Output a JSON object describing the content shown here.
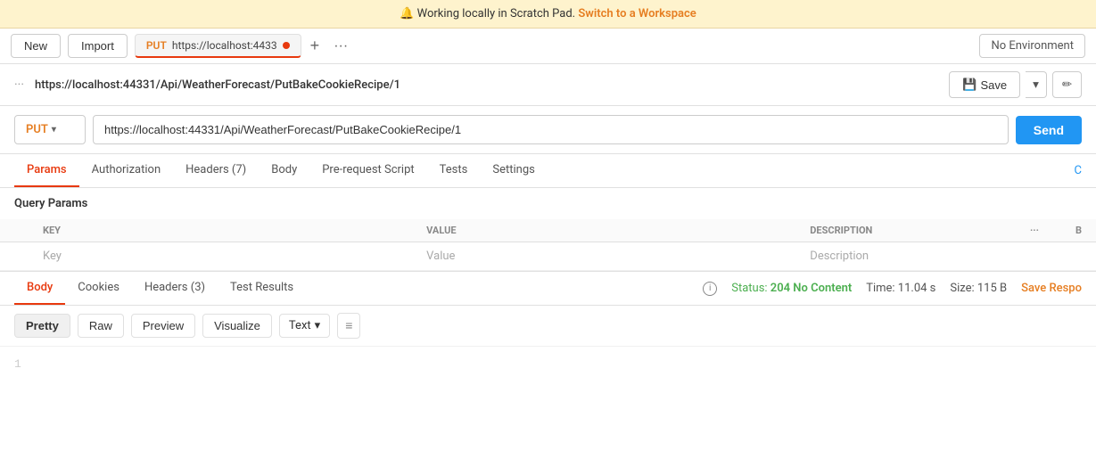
{
  "banner": {
    "icon": "🔔",
    "text": "Working locally in Scratch Pad.",
    "link_text": "Switch to a Workspace"
  },
  "toolbar": {
    "new_label": "New",
    "import_label": "Import",
    "tab": {
      "method": "PUT",
      "url": "https://localhost:4433",
      "has_dot": true
    },
    "environment": "No Environment"
  },
  "url_bar": {
    "three_dots": "···",
    "url": "https://localhost:44331/Api/WeatherForecast/PutBakeCookieRecipe/1",
    "save_label": "Save",
    "edit_icon": "✏"
  },
  "request": {
    "method": "PUT",
    "url": "https://localhost:44331/Api/WeatherForecast/PutBakeCookieRecipe/1",
    "send_label": "Send"
  },
  "tabs": {
    "items": [
      {
        "label": "Params",
        "active": true
      },
      {
        "label": "Authorization"
      },
      {
        "label": "Headers (7)"
      },
      {
        "label": "Body"
      },
      {
        "label": "Pre-request Script"
      },
      {
        "label": "Tests"
      },
      {
        "label": "Settings"
      }
    ],
    "extra": "C"
  },
  "params": {
    "section_title": "Query Params",
    "columns": [
      "KEY",
      "VALUE",
      "DESCRIPTION"
    ],
    "empty_row": {
      "key_placeholder": "Key",
      "value_placeholder": "Value",
      "desc_placeholder": "Description"
    }
  },
  "response": {
    "tabs": [
      {
        "label": "Body",
        "active": true
      },
      {
        "label": "Cookies"
      },
      {
        "label": "Headers (3)"
      },
      {
        "label": "Test Results"
      }
    ],
    "status": "204",
    "status_text": "No Content",
    "time": "11.04 s",
    "size": "115 B",
    "save_label": "Save Respo",
    "format_buttons": [
      "Pretty",
      "Raw",
      "Preview",
      "Visualize"
    ],
    "active_format": "Pretty",
    "format_type": "Text",
    "line_numbers": [
      "1"
    ],
    "body_content": ""
  },
  "icons": {
    "three_dots": "···",
    "plus": "+",
    "chevron_down": "▾",
    "save_icon": "💾",
    "info_circle": "i",
    "wrap_icon": "≡"
  }
}
